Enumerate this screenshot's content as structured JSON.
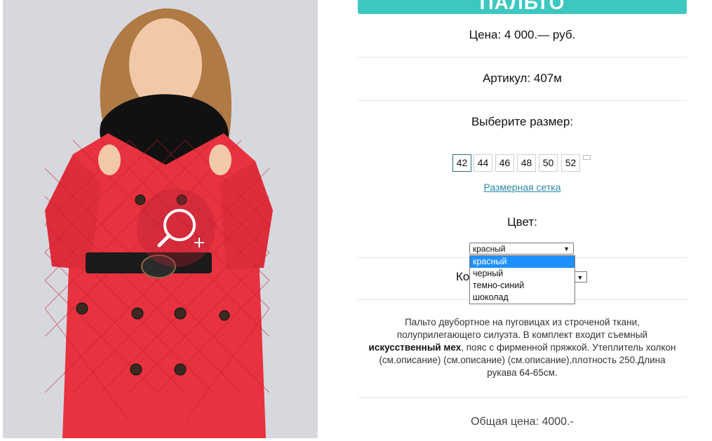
{
  "product": {
    "title": "ПАЛЬТО",
    "price_line": "Цена: 4 000.— руб.",
    "article_line": "Артикул: 407м",
    "size_heading": "Выберите размер:",
    "sizes": [
      "42",
      "44",
      "46",
      "48",
      "50",
      "52"
    ],
    "selected_size": "42",
    "size_chart_link": "Размерная сетка",
    "color_heading": "Цвет:",
    "color_select_value": "красный",
    "color_options": [
      "красный",
      "черный",
      "темно-синий",
      "шоколад"
    ],
    "highlighted_color": "красный",
    "qty_label_partial": "Ко",
    "description_part1": "Пальто двубортное на пуговицах из строченой ткани, полуприлегающего силуэта. В комплект входит съемный ",
    "description_bold": "искусственный мех",
    "description_part2": ", пояс с фирменной пряжкой. Утеплитель холкон (см.описание) (см.описание) (см.описание),плотность 250.Длина рукава 64-65см.",
    "total_line": "Общая цена: 4000.-"
  },
  "icons": {
    "zoom": "zoom-in-icon",
    "dropdown_arrow": "triangle-down-icon"
  },
  "colors": {
    "accent": "#3cc8c0",
    "highlight": "#1e90ff",
    "link": "#2a8aa8",
    "coat": "#e8323f"
  }
}
